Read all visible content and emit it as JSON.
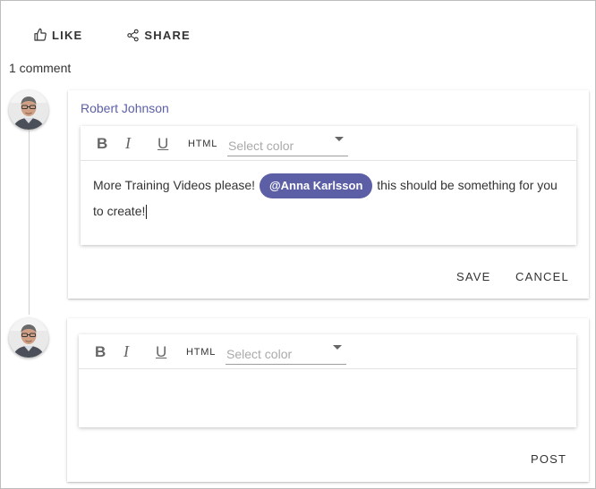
{
  "actions": {
    "like_label": "LIKE",
    "share_label": "SHARE"
  },
  "comments_count_text": "1 comment",
  "comment": {
    "author": "Robert Johnson",
    "text_before": "More Training Videos please!",
    "mention": "@Anna Karlsson",
    "text_after": "this should be something for you to create!",
    "save_label": "SAVE",
    "cancel_label": "CANCEL"
  },
  "editor_toolbar": {
    "bold": "B",
    "italic": "I",
    "underline": "U",
    "html": "HTML",
    "color_placeholder": "Select color"
  },
  "new_comment": {
    "text": "",
    "post_label": "POST"
  },
  "colors": {
    "accent": "#5c5fa6",
    "text": "#333333",
    "border": "#bdbdbd"
  }
}
